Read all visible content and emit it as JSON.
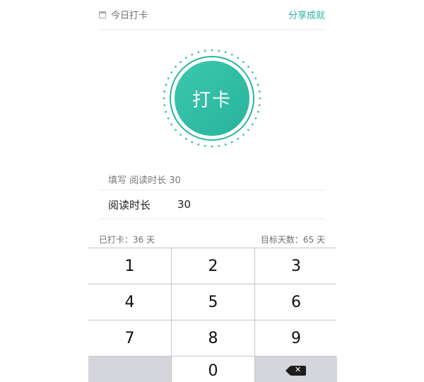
{
  "header": {
    "calendar_icon": "calendar-icon",
    "today_label": "今日打卡",
    "share_label": "分享成就"
  },
  "checkin": {
    "button_label": "打卡",
    "accent": "#2bb5a0"
  },
  "form": {
    "hint": "填写 阅读时长 30",
    "field_label": "阅读时长",
    "field_value": "30"
  },
  "stats": {
    "checked_in": "已打卡：36 天",
    "target_days": "目标天数：65 天"
  },
  "keypad": {
    "keys": [
      "1",
      "2",
      "3",
      "4",
      "5",
      "6",
      "7",
      "8",
      "9",
      "0"
    ],
    "delete_icon": "backspace-icon"
  }
}
